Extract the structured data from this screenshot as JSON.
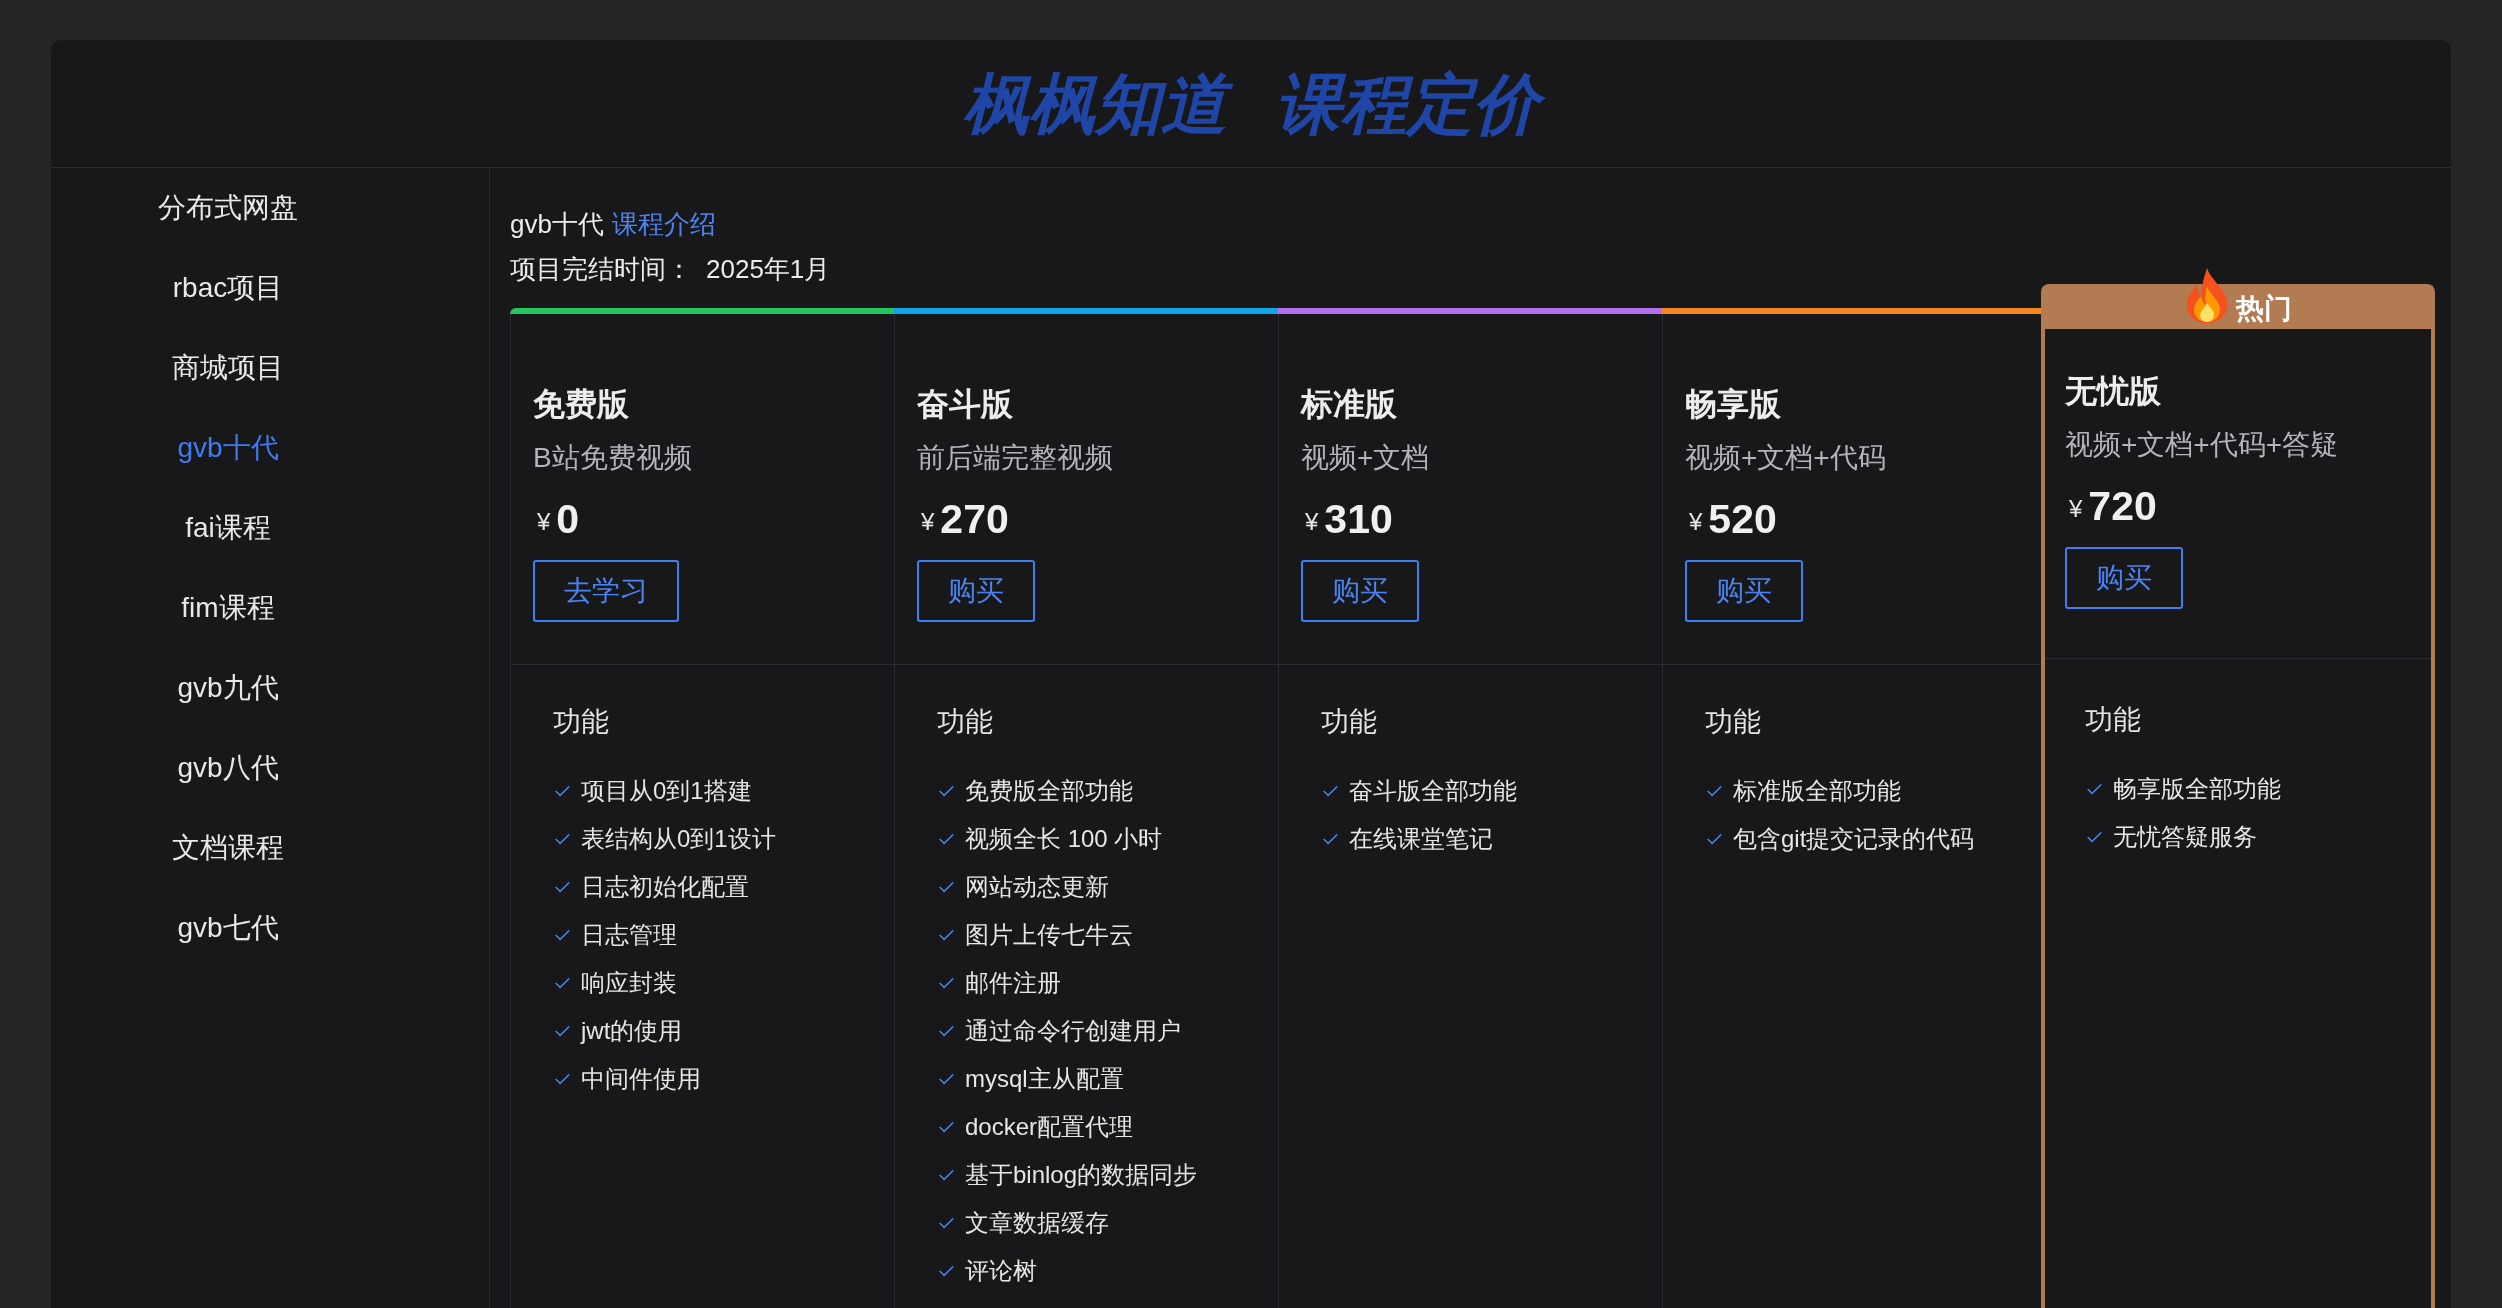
{
  "title": "枫枫知道 课程定价",
  "sidebar": {
    "items": [
      {
        "label": "分布式网盘",
        "selected": false
      },
      {
        "label": "rbac项目",
        "selected": false
      },
      {
        "label": "商城项目",
        "selected": false
      },
      {
        "label": "gvb十代",
        "selected": true
      },
      {
        "label": "fai课程",
        "selected": false
      },
      {
        "label": "fim课程",
        "selected": false
      },
      {
        "label": "gvb九代",
        "selected": false
      },
      {
        "label": "gvb八代",
        "selected": false
      },
      {
        "label": "文档课程",
        "selected": false
      },
      {
        "label": "gvb七代",
        "selected": false
      }
    ]
  },
  "course": {
    "name": "gvb十代",
    "intro_link": "课程介绍",
    "finish_label": "项目完结时间：",
    "finish_date": "2025年1月"
  },
  "plans": [
    {
      "name": "免费版",
      "subtitle": "B站免费视频",
      "currency": "¥",
      "price": "0",
      "button": "去学习",
      "color": "#22c55e",
      "features_title": "功能",
      "features": [
        "项目从0到1搭建",
        "表结构从0到1设计",
        "日志初始化配置",
        "日志管理",
        "响应封装",
        "jwt的使用",
        "中间件使用"
      ]
    },
    {
      "name": "奋斗版",
      "subtitle": "前后端完整视频",
      "currency": "¥",
      "price": "270",
      "button": "购买",
      "color": "#0ea5e9",
      "features_title": "功能",
      "features": [
        "免费版全部功能",
        "视频全长 100 小时",
        "网站动态更新",
        "图片上传七牛云",
        "邮件注册",
        "通过命令行创建用户",
        "mysql主从配置",
        "docker配置代理",
        "基于binlog的数据同步",
        "文章数据缓存",
        "评论树"
      ]
    },
    {
      "name": "标准版",
      "subtitle": "视频+文档",
      "currency": "¥",
      "price": "310",
      "button": "购买",
      "color": "#b36ef2",
      "features_title": "功能",
      "features": [
        "奋斗版全部功能",
        "在线课堂笔记"
      ]
    },
    {
      "name": "畅享版",
      "subtitle": "视频+文档+代码",
      "currency": "¥",
      "price": "520",
      "button": "购买",
      "color": "#f7861e",
      "features_title": "功能",
      "features": [
        "标准版全部功能",
        "包含git提交记录的代码"
      ]
    },
    {
      "name": "无忧版",
      "subtitle": "视频+文档+代码+答疑",
      "currency": "¥",
      "price": "720",
      "button": "购买",
      "color": "#b27b52",
      "badge": "热门",
      "features_title": "功能",
      "features": [
        "畅享版全部功能",
        "无忧答疑服务"
      ]
    }
  ]
}
